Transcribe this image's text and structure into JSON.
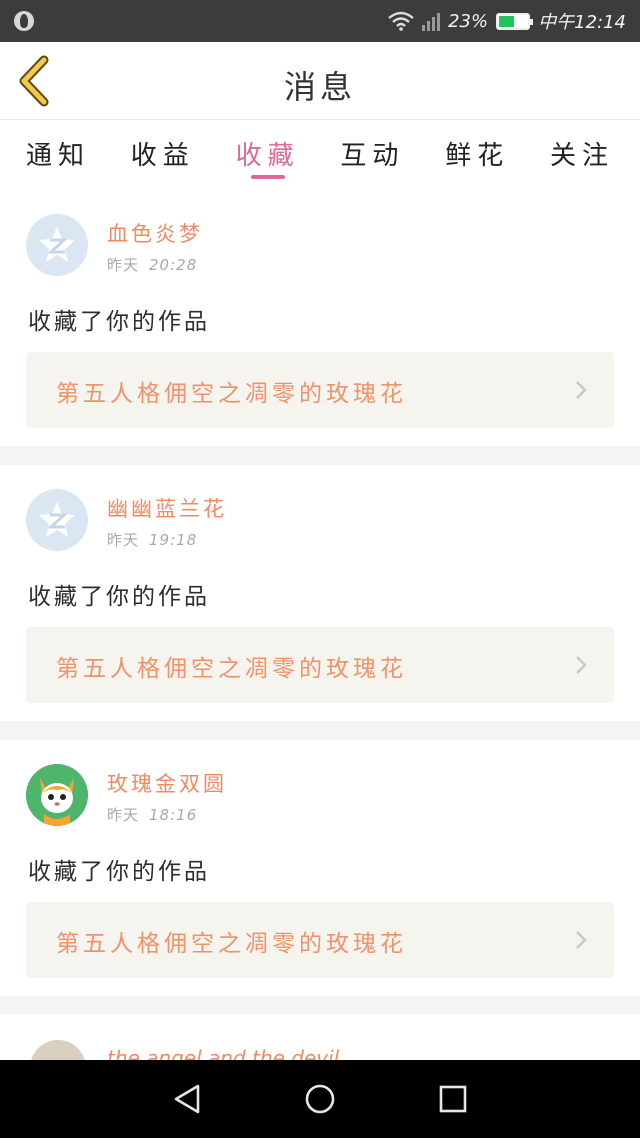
{
  "status_bar": {
    "battery": "23%",
    "time": "中午12:14",
    "icons": [
      "globe-icon",
      "wifi-icon",
      "signal-icon",
      "battery-charging-icon"
    ]
  },
  "header": {
    "title": "消息",
    "back_icon": "chevron-left-icon",
    "accent_color": "#e0689a"
  },
  "tabs": [
    {
      "label": "通知",
      "active": false
    },
    {
      "label": "收益",
      "active": false
    },
    {
      "label": "收藏",
      "active": true
    },
    {
      "label": "互动",
      "active": false
    },
    {
      "label": "鲜花",
      "active": false
    },
    {
      "label": "关注",
      "active": false
    }
  ],
  "messages": [
    {
      "username": "血色炎梦",
      "day": "昨天",
      "time": "20:28",
      "action": "收藏了你的作品",
      "work_title": "第五人格佣空之凋零的玫瑰花",
      "avatar": "default-z-icon"
    },
    {
      "username": "幽幽蓝兰花",
      "day": "昨天",
      "time": "19:18",
      "action": "收藏了你的作品",
      "work_title": "第五人格佣空之凋零的玫瑰花",
      "avatar": "default-z-icon"
    },
    {
      "username": "玫瑰金双圆",
      "day": "昨天",
      "time": "18:16",
      "action": "收藏了你的作品",
      "work_title": "第五人格佣空之凋零的玫瑰花",
      "avatar": "cartoon-fox-avatar"
    }
  ],
  "partial_message": {
    "username": "the angel and the devil"
  },
  "nav_bar": {
    "icons": [
      "back-triangle-icon",
      "home-circle-icon",
      "recent-square-icon"
    ]
  }
}
